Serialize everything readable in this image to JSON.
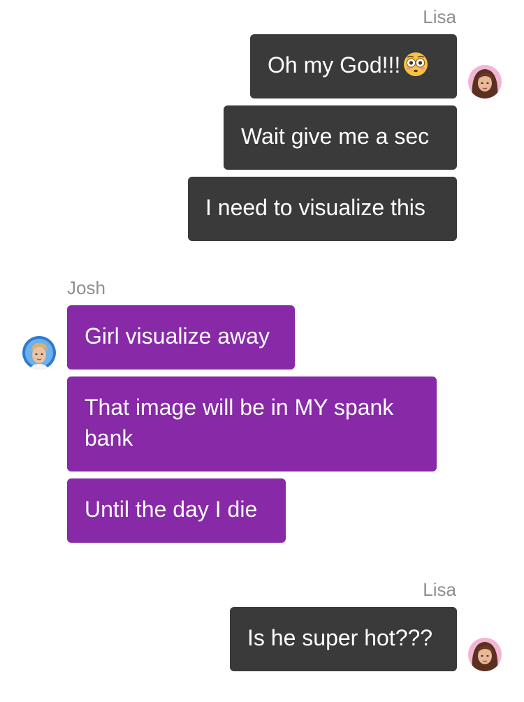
{
  "groups": [
    {
      "sender": "Lisa",
      "messages": [
        {
          "text": "Oh my God!!!",
          "emoji": "flushed-face-icon"
        },
        {
          "text": "Wait give me a sec"
        },
        {
          "text": "I need to visualize this"
        }
      ]
    },
    {
      "sender": "Josh",
      "messages": [
        {
          "text": "Girl visualize away"
        },
        {
          "text": "That image will be in MY spank bank"
        },
        {
          "text": "Until the day I die"
        }
      ]
    },
    {
      "sender": "Lisa",
      "messages": [
        {
          "text": "Is he super hot???"
        }
      ]
    }
  ],
  "colors": {
    "outgoing_bubble": "#3a3a3a",
    "incoming_bubble": "#8829a8",
    "sender_label": "#8e8e93"
  }
}
